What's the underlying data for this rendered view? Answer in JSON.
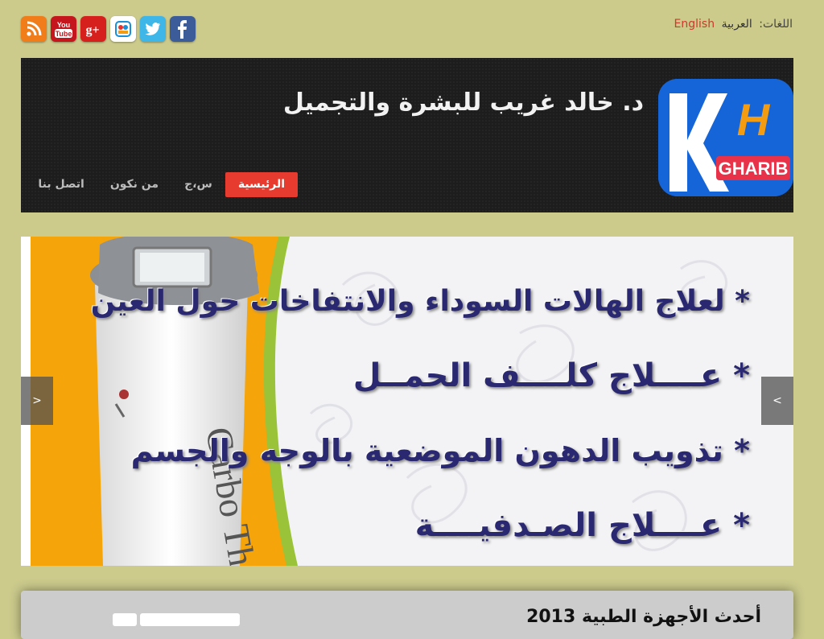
{
  "topbar": {
    "social": [
      {
        "name": "rss-icon",
        "color": "#f07d1a",
        "glyph": "rss"
      },
      {
        "name": "youtube-icon",
        "color": "#c4161c",
        "glyph": "You Tube"
      },
      {
        "name": "google-plus-icon",
        "color": "#d6201e",
        "glyph": "g+"
      },
      {
        "name": "stumbleupon-icon",
        "color": "#ffffff",
        "glyph": "su"
      },
      {
        "name": "twitter-icon",
        "color": "#3fb6e8",
        "glyph": "t"
      },
      {
        "name": "facebook-icon",
        "color": "#3b5b99",
        "glyph": "f"
      }
    ],
    "languages_label": "اللغات:",
    "current_language": "العربية",
    "other_language": "English"
  },
  "header": {
    "site_title": "د. خالد غريب للبشرة والتجميل",
    "logo_text": "GHARIB",
    "nav": [
      {
        "label": "الرئيسية",
        "active": true
      },
      {
        "label": "س،ج",
        "active": false
      },
      {
        "label": "من نكون",
        "active": false
      },
      {
        "label": "اتصل بنا",
        "active": false
      }
    ]
  },
  "slider": {
    "lines": [
      "* لعلاج الهالات السوداء والانتفاخات حول العين",
      "* عــــلاج كلــــف الحمــل",
      "* تذويب الدهون الموضعية بالوجه والجسم",
      "* عــــلاج الصـدفيــــة"
    ],
    "device_text": "Carbo The",
    "prev_label": ">",
    "next_label": "<"
  },
  "panel": {
    "title_partial": "أحدث الأجهزة الطبية 2013"
  },
  "colors": {
    "background": "#cccb8c",
    "header_bg": "#1d1d1d",
    "nav_active": "#e63b2e",
    "language_link": "#cc3a2d",
    "slide_text": "#2a2870"
  }
}
